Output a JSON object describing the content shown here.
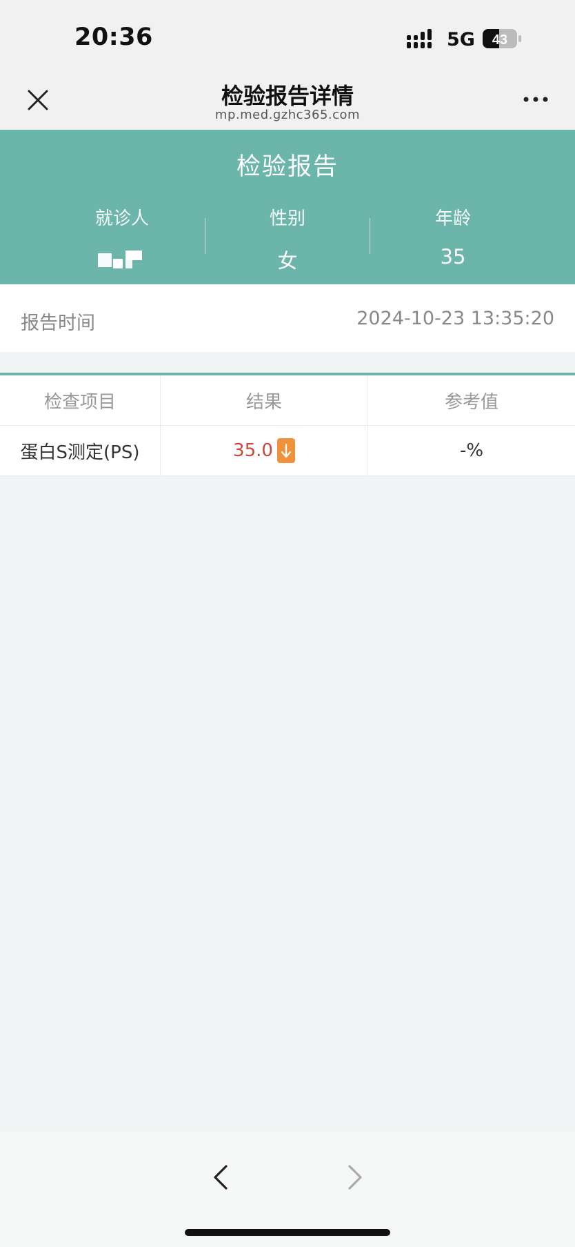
{
  "status_bar": {
    "time": "20:36",
    "network": "5G",
    "battery": "43"
  },
  "nav": {
    "title": "检验报告详情",
    "url": "mp.med.gzhc365.com"
  },
  "report": {
    "title": "检验报告",
    "patient_label": "就诊人",
    "gender_label": "性别",
    "gender_value": "女",
    "age_label": "年龄",
    "age_value": "35"
  },
  "report_time": {
    "label": "报告时间",
    "value": "2024-10-23 13:35:20"
  },
  "table": {
    "headers": [
      "检查项目",
      "结果",
      "参考值"
    ],
    "rows": [
      {
        "item": "蛋白S测定(PS)",
        "result": "35.0",
        "flag_icon": "arrow-down-icon",
        "reference": "-%"
      }
    ]
  },
  "colors": {
    "accent": "#6bb5aa",
    "result_low": "#d0453a",
    "flag": "#f0923c"
  }
}
